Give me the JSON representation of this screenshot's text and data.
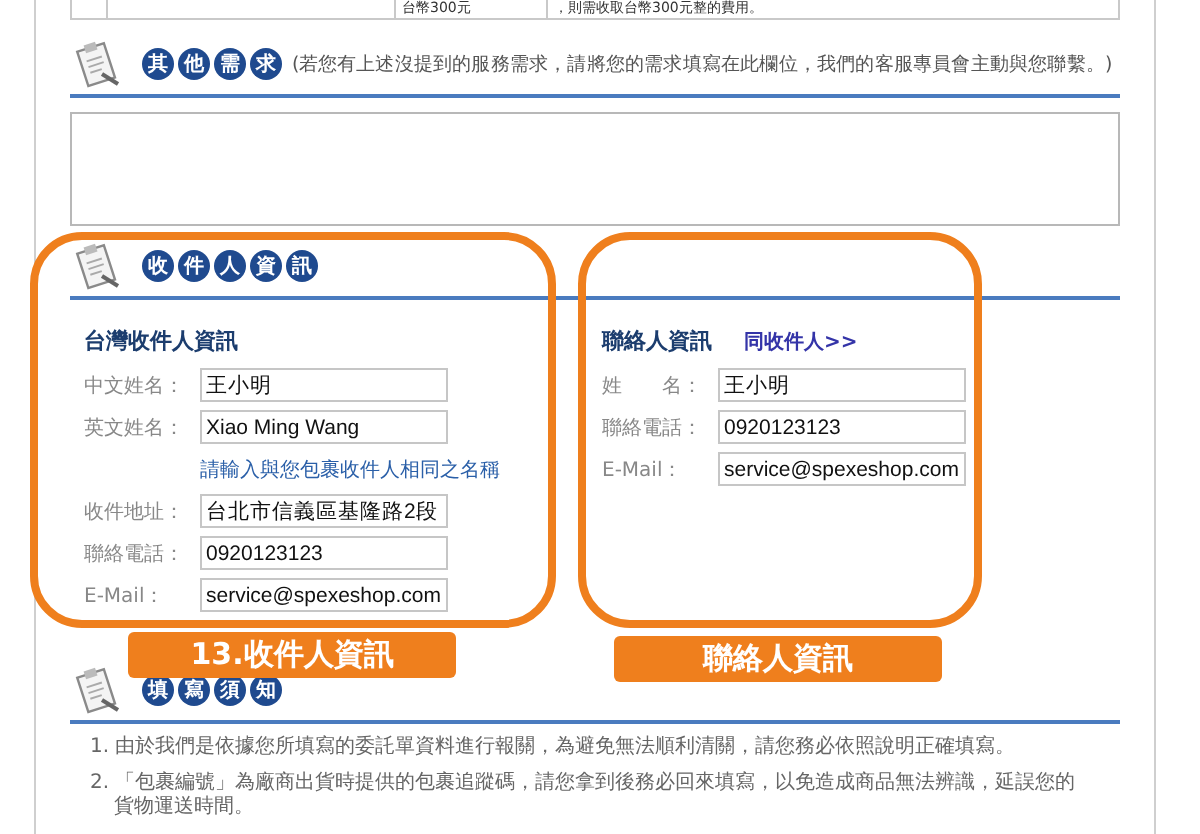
{
  "top_table_row": {
    "cells": [
      "台幣300元",
      "，則需收取台幣300元整的費用。"
    ]
  },
  "other_needs": {
    "title_chars": [
      "其",
      "他",
      "需",
      "求"
    ],
    "note": "(若您有上述沒提到的服務需求，請將您的需求填寫在此欄位，我們的客服專員會主動與您聯繫。)"
  },
  "recipient_section": {
    "title_chars": [
      "收",
      "件",
      "人",
      "資",
      "訊"
    ],
    "recipient": {
      "heading": "台灣收件人資訊",
      "rows": [
        {
          "kind": "field",
          "label": "中文姓名：",
          "value": "王小明"
        },
        {
          "kind": "field",
          "label": "英文姓名：",
          "value": "Xiao Ming Wang"
        },
        {
          "kind": "hint",
          "text": "請輸入與您包裹收件人相同之名稱"
        },
        {
          "kind": "field",
          "label": "收件地址：",
          "value": "台北市信義區基隆路2段"
        },
        {
          "kind": "field",
          "label": "聯絡電話：",
          "value": "0920123123"
        },
        {
          "kind": "field",
          "label": "E-Mail：",
          "value": "service@spexeshop.com"
        }
      ]
    },
    "contact": {
      "heading": "聯絡人資訊",
      "link": "同收件人>>",
      "rows": [
        {
          "kind": "field",
          "label": "姓　　名：",
          "value": "王小明"
        },
        {
          "kind": "field",
          "label": "聯絡電話：",
          "value": "0920123123"
        },
        {
          "kind": "field",
          "label": "E-Mail：",
          "value": "service@spexeshop.com"
        }
      ]
    }
  },
  "notes_section": {
    "title_chars": [
      "填",
      "寫",
      "須",
      "知"
    ],
    "items": [
      "1. 由於我們是依據您所填寫的委託單資料進行報關，為避免無法順利清關，請您務必依照說明正確填寫。",
      "2. 「包裹編號」為廠商出貨時提供的包裹追蹤碼，請您拿到後務必回來填寫，以免造成商品無法辨識，延誤您的貨物運送時間。"
    ]
  },
  "callouts": [
    {
      "label": "13.收件人資訊"
    },
    {
      "label": "聯絡人資訊"
    }
  ]
}
